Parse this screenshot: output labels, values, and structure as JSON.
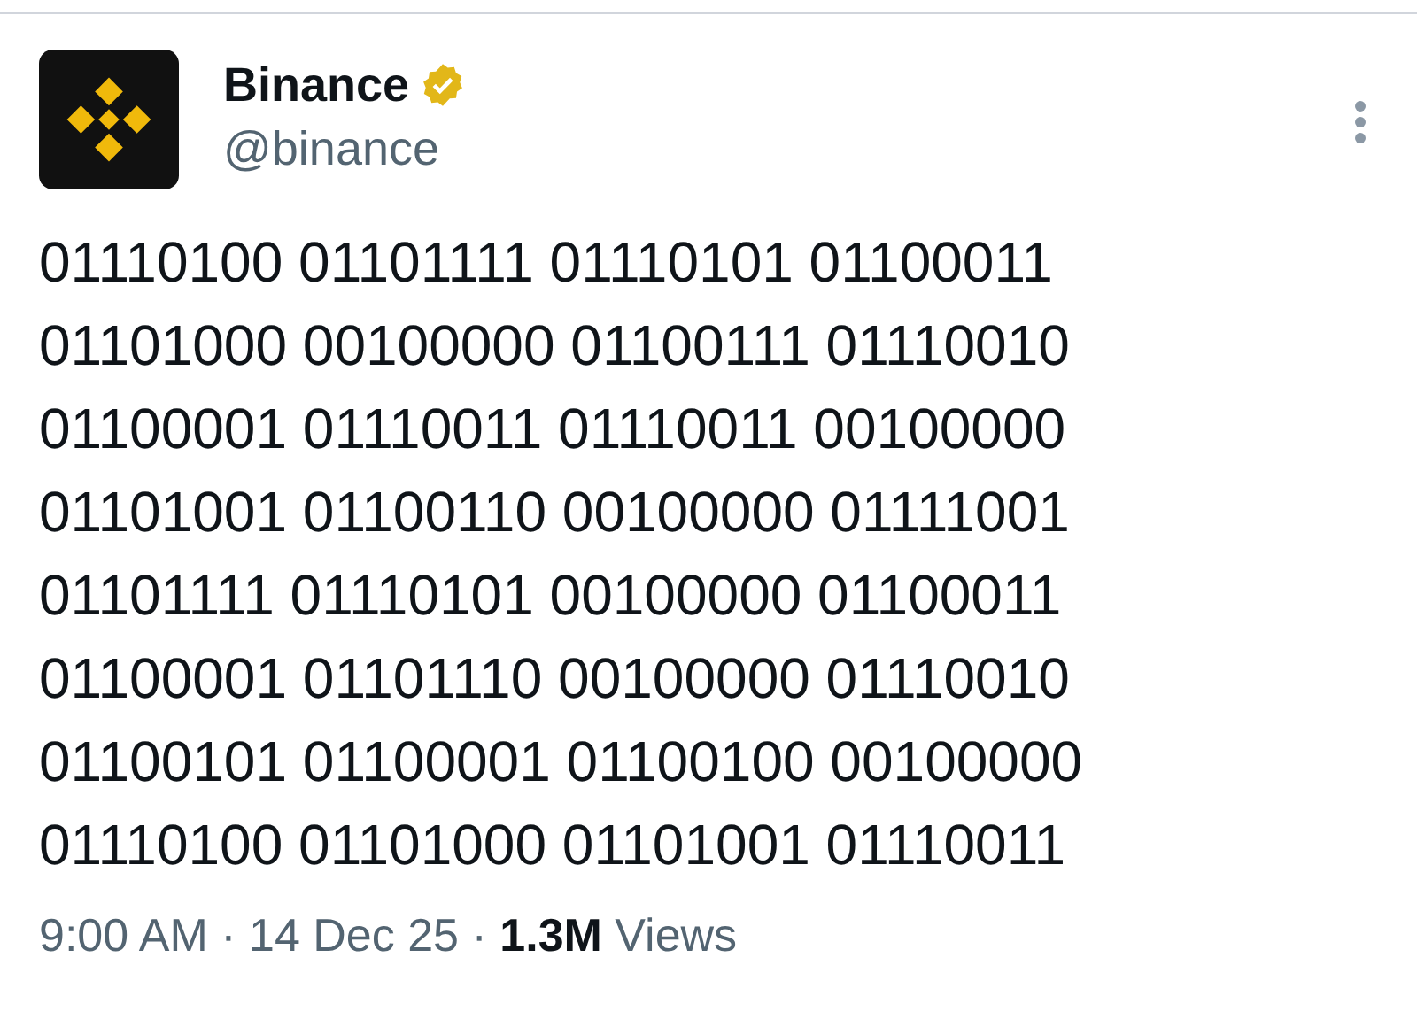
{
  "author": {
    "name": "Binance",
    "handle": "@binance",
    "verified": true
  },
  "body_lines": [
    "01110100 01101111 01110101 01100011",
    "01101000 00100000 01100111 01110010",
    "01100001 01110011 01110011 00100000",
    "01101001 01100110 00100000 01111001",
    "01101111 01110101 00100000 01100011",
    "01100001 01101110 00100000 01110010",
    "01100101 01100001 01100100 00100000",
    "01110100 01101000 01101001 01110011"
  ],
  "footer": "9:00 AM · 14 Dec 25 · **1.3M** Views"
}
